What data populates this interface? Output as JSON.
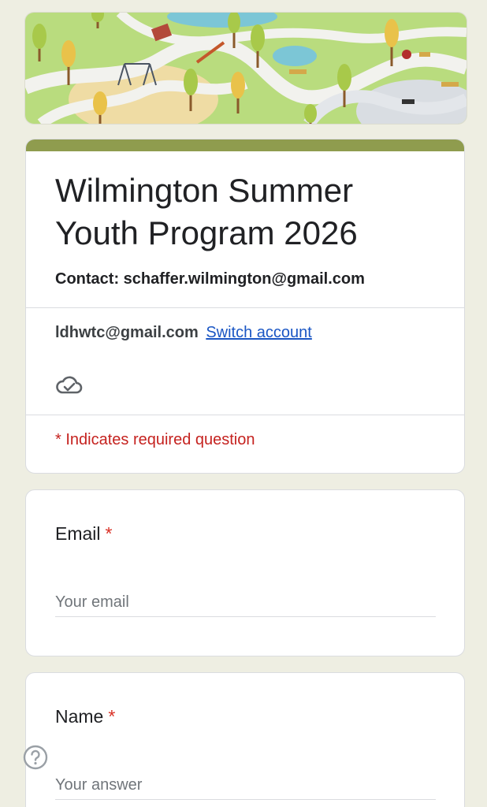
{
  "form": {
    "title": "Wilmington Summer Youth Program 2026",
    "contact": "Contact: schaffer.wilmington@gmail.com",
    "account_email": "ldhwtc@gmail.com",
    "switch_account": "Switch account",
    "required_note": "* Indicates required question",
    "accent_color": "#8f9c4e"
  },
  "icons": {
    "cloud": "cloud-check-icon",
    "help": "help-circle-icon"
  },
  "questions": [
    {
      "label": "Email",
      "required_mark": "*",
      "placeholder": "Your email"
    },
    {
      "label": "Name",
      "required_mark": "*",
      "placeholder": "Your answer"
    }
  ]
}
